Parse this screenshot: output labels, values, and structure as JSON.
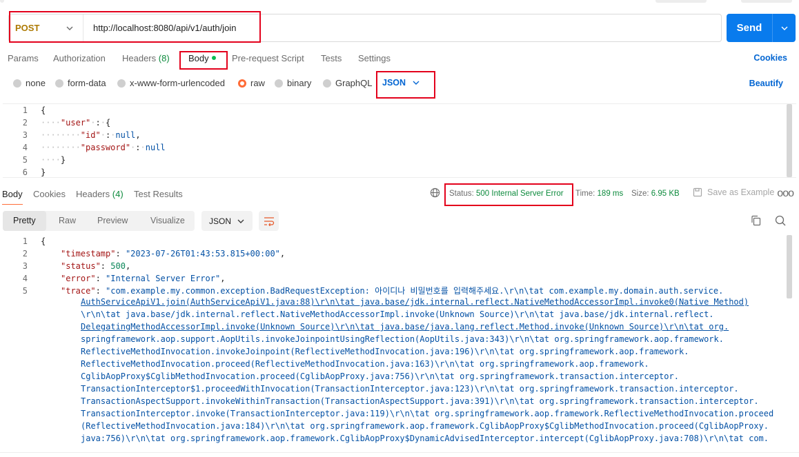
{
  "request": {
    "method": "POST",
    "url": "http://localhost:8080/api/v1/auth/join",
    "send_label": "Send"
  },
  "request_tabs": {
    "params": "Params",
    "authorization": "Authorization",
    "headers": "Headers",
    "headers_count": "(8)",
    "body": "Body",
    "prerequest": "Pre-request Script",
    "tests": "Tests",
    "settings": "Settings",
    "cookies": "Cookies"
  },
  "body_types": {
    "none": "none",
    "form_data": "form-data",
    "urlencoded": "x-www-form-urlencoded",
    "raw": "raw",
    "binary": "binary",
    "graphql": "GraphQL",
    "format": "JSON",
    "beautify": "Beautify"
  },
  "request_body": {
    "line_numbers": [
      "1",
      "2",
      "3",
      "4",
      "5",
      "6"
    ],
    "open_brace": "{",
    "user_key": "\"user\"",
    "id_key": "\"id\"",
    "password_key": "\"password\"",
    "null_value": "null",
    "close_brace": "}"
  },
  "response_tabs": {
    "body": "Body",
    "cookies": "Cookies",
    "headers": "Headers",
    "headers_count": "(4)",
    "test_results": "Test Results",
    "status_label": "Status:",
    "status_value": "500 Internal Server Error",
    "time_label": "Time:",
    "time_value": "189 ms",
    "size_label": "Size:",
    "size_value": "6.95 KB",
    "save_example": "Save as Example",
    "more": "ooo"
  },
  "response_view": {
    "pretty": "Pretty",
    "raw": "Raw",
    "preview": "Preview",
    "visualize": "Visualize",
    "format": "JSON"
  },
  "response_body": {
    "line_numbers": [
      "1",
      "2",
      "3",
      "4",
      "5"
    ],
    "open_brace": "{",
    "timestamp_key": "\"timestamp\"",
    "timestamp_value": "\"2023-07-26T01:43:53.815+00:00\"",
    "status_key": "\"status\"",
    "status_value": "500",
    "error_key": "\"error\"",
    "error_value": "\"Internal Server Error\"",
    "trace_key": "\"trace\"",
    "trace_lines": [
      "\"com.example.my.common.exception.BadRequestException: 아이디나 비밀번호를 입력해주세요.\\r\\n\\tat com.example.my.domain.auth.service.",
      "AuthServiceApiV1.join(AuthServiceApiV1.java:88)\\r\\n\\tat java.base/jdk.internal.reflect.NativeMethodAccessorImpl.invoke0(Native Method)",
      "\\r\\n\\tat java.base/jdk.internal.reflect.NativeMethodAccessorImpl.invoke(Unknown Source)\\r\\n\\tat java.base/jdk.internal.reflect.",
      "DelegatingMethodAccessorImpl.invoke(Unknown Source)\\r\\n\\tat java.base/java.lang.reflect.Method.invoke(Unknown Source)\\r\\n\\tat org.",
      "springframework.aop.support.AopUtils.invokeJoinpointUsingReflection(AopUtils.java:343)\\r\\n\\tat org.springframework.aop.framework.",
      "ReflectiveMethodInvocation.invokeJoinpoint(ReflectiveMethodInvocation.java:196)\\r\\n\\tat org.springframework.aop.framework.",
      "ReflectiveMethodInvocation.proceed(ReflectiveMethodInvocation.java:163)\\r\\n\\tat org.springframework.aop.framework.",
      "CglibAopProxy$CglibMethodInvocation.proceed(CglibAopProxy.java:756)\\r\\n\\tat org.springframework.transaction.interceptor.",
      "TransactionInterceptor$1.proceedWithInvocation(TransactionInterceptor.java:123)\\r\\n\\tat org.springframework.transaction.interceptor.",
      "TransactionAspectSupport.invokeWithinTransaction(TransactionAspectSupport.java:391)\\r\\n\\tat org.springframework.transaction.interceptor.",
      "TransactionInterceptor.invoke(TransactionInterceptor.java:119)\\r\\n\\tat org.springframework.aop.framework.ReflectiveMethodInvocation.proceed",
      "(ReflectiveMethodInvocation.java:184)\\r\\n\\tat org.springframework.aop.framework.CglibAopProxy$CglibMethodInvocation.proceed(CglibAopProxy.",
      "java:756)\\r\\n\\tat org.springframework.aop.framework.CglibAopProxy$DynamicAdvisedInterceptor.intercept(CglibAopProxy.java:708)\\r\\n\\tat com."
    ]
  },
  "colors": {
    "accent": "#097bed",
    "method": "#ad7a03",
    "status_ok_text": "#0c8a3c",
    "highlight": "#e3001b"
  }
}
